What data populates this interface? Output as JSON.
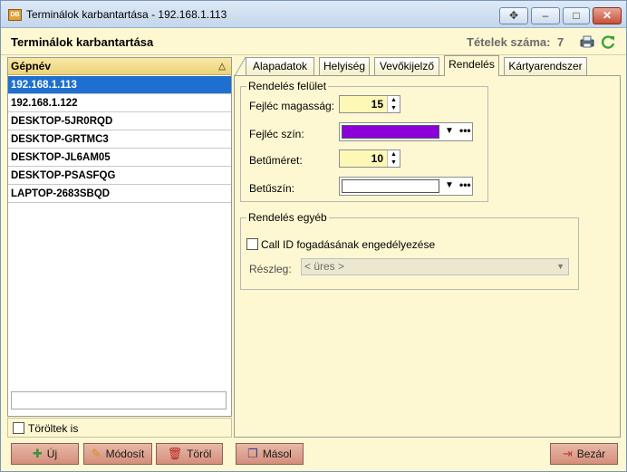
{
  "window": {
    "app_icon": "DB",
    "title": "Terminálok karbantartása - 192.168.1.113",
    "controls": {
      "move": "✥",
      "minimize": "–",
      "maximize": "□",
      "close": "✕"
    }
  },
  "header": {
    "title": "Terminálok karbantartása",
    "count_label": "Tételek száma:",
    "count_value": "7",
    "icons": [
      "print-icon",
      "refresh-icon"
    ]
  },
  "grid": {
    "column_header": "Gépnév",
    "rows": [
      "192.168.1.113",
      "192.168.1.122",
      "DESKTOP-5JR0RQD",
      "DESKTOP-GRTMC3",
      "DESKTOP-JL6AM05",
      "DESKTOP-PSASFQG",
      "LAPTOP-2683SBQD"
    ],
    "selected_index": 0,
    "search_value": "",
    "deleted_checkbox_label": "Töröltek is",
    "deleted_checked": false
  },
  "tabs": [
    {
      "label": "Alapadatok",
      "active": false
    },
    {
      "label": "Helyiség",
      "active": false
    },
    {
      "label": "Vevőkijelző",
      "active": false
    },
    {
      "label": "Rendelés",
      "active": true
    },
    {
      "label": "Kártyarendszer",
      "active": false
    }
  ],
  "order_surface": {
    "title": "Rendelés felület",
    "header_height_label": "Fejléc magasság:",
    "header_height_value": "15",
    "header_color_label": "Fejléc szín:",
    "header_color": "#8b00d8",
    "font_size_label": "Betűméret:",
    "font_size_value": "10",
    "font_color_label": "Betűszín:",
    "font_color": "#ffffff",
    "ellipsis": "•••"
  },
  "order_other": {
    "title": "Rendelés egyéb",
    "call_id_label": "Call ID fogadásának engedélyezése",
    "call_id_checked": false,
    "department_label": "Részleg:",
    "department_value": "< üres >"
  },
  "buttons": {
    "new": "Új",
    "modify": "Módosít",
    "delete": "Töröl",
    "copy": "Másol",
    "close": "Bezár"
  },
  "colors": {
    "selection": "#1e6fd0",
    "background": "#fdf8d2",
    "button": "#d9998a"
  }
}
